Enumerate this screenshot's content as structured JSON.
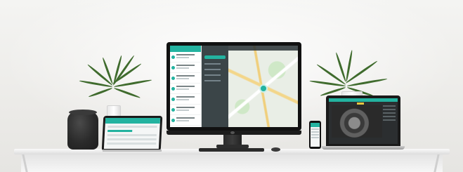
{
  "scene": {
    "accent_color": "#23b3a0",
    "devices": [
      "smart-speaker",
      "tablet",
      "desktop-monitor",
      "phone",
      "laptop"
    ],
    "monitor_app": {
      "header_label": "",
      "nav_title": "",
      "map_marker_color": "#23b3a0"
    }
  }
}
